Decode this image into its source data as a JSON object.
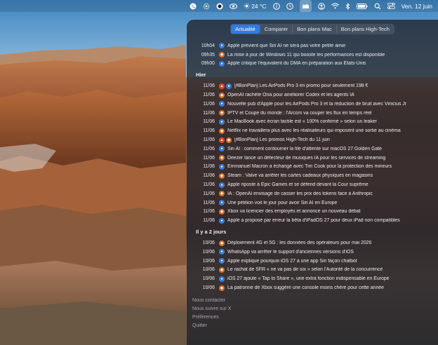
{
  "menubar": {
    "weather": "24 °C",
    "datetime": "Ven. 12 juin"
  },
  "tabs": [
    {
      "label": "Actualité",
      "active": true
    },
    {
      "label": "Comparer",
      "active": false
    },
    {
      "label": "Bon plans Mac",
      "active": false
    },
    {
      "label": "Bon plans High-Tech",
      "active": false
    }
  ],
  "sections": {
    "today": [
      {
        "time": "10h04",
        "icon": "blue",
        "title": "Apple prévient que Siri AI ne sera pas votre petite amie"
      },
      {
        "time": "09h35",
        "icon": "orange",
        "title": "La mise à jour de Windows 11 qui booste les performances est disponible"
      },
      {
        "time": "09h00",
        "icon": "blue",
        "title": "Apple critique l'équivalent du DMA en préparation aux États-Unis"
      }
    ],
    "yesterday_label": "Hier",
    "yesterday": [
      {
        "time": "11/06",
        "fire": true,
        "icon": "blue",
        "title": "[#BonPlan] Les AirPods Pro 3 en promo pour seulement 198 €"
      },
      {
        "time": "11/06",
        "icon": "orange",
        "title": "OpenAI rachète Ona pour améliorer Codex et les agents IA"
      },
      {
        "time": "11/06",
        "icon": "blue",
        "title": "Nouvelle pub d'Apple pour les AirPods Pro 3 et la réduction de bruit avec Vinicius Jr"
      },
      {
        "time": "11/06",
        "icon": "orange",
        "title": "IPTV et Coupe du monde : l'Arcom va couper les flux en temps réel"
      },
      {
        "time": "11/06",
        "icon": "blue",
        "title": "Le MacBook avec écran tactile est « 100% confirmé » selon un leaker"
      },
      {
        "time": "11/06",
        "icon": "orange",
        "title": "Netflix ne travaillera plus avec les réalisateurs qui imposent une sortie au cinéma"
      },
      {
        "time": "11/06",
        "fire": true,
        "icon": "orange",
        "title": "[#BonPlan] Les promos High-Tech du 11 juin"
      },
      {
        "time": "11/06",
        "icon": "blue",
        "title": "Siri AI : comment contourner la file d'attente sur macOS 27 Golden Gate"
      },
      {
        "time": "11/06",
        "icon": "orange",
        "title": "Deezer lance un détecteur de musiques IA pour les services de streaming"
      },
      {
        "time": "11/06",
        "icon": "blue",
        "title": "Emmanuel Macron a échangé avec Tim Cook pour la protection des mineurs"
      },
      {
        "time": "11/06",
        "icon": "orange",
        "title": "Steam : Valve va arrêter les cartes cadeaux physiques en magasins"
      },
      {
        "time": "11/06",
        "icon": "blue",
        "title": "Apple riposte à Epic Games et se défend devant la Cour suprême"
      },
      {
        "time": "11/06",
        "icon": "orange",
        "title": "IA : OpenAI envisage de casser les prix des tokens face à Anthropic"
      },
      {
        "time": "11/06",
        "icon": "blue",
        "title": "Une pétition voit le jour pour avoir Siri AI en Europe"
      },
      {
        "time": "11/06",
        "icon": "orange",
        "title": "Xbox va licencier des employés et annonce un nouveau débat"
      },
      {
        "time": "11/06",
        "icon": "blue",
        "title": "Apple a proposé par erreur la bêta d'iPadOS 27 pour deux iPad non compatibles"
      }
    ],
    "older_label": "Il y a 2 jours",
    "older": [
      {
        "time": "10/06",
        "icon": "orange",
        "title": "Déploiement 4G et 5G : les données des opérateurs pour mai 2026"
      },
      {
        "time": "10/06",
        "icon": "blue",
        "title": "WhatsApp va arrêter le support d'anciennes versions d'iOS"
      },
      {
        "time": "10/06",
        "icon": "blue",
        "title": "Apple explique pourquoi iOS 27 a une app Siri façon chatbot"
      },
      {
        "time": "10/06",
        "icon": "orange",
        "title": "Le rachat de SFR « ne va pas de soi » selon l'Autorité de la concurrence"
      },
      {
        "time": "10/06",
        "icon": "blue",
        "title": "iOS 27 ajoute « Tap to Share », une extra fonction indispensable en Europe"
      },
      {
        "time": "10/06",
        "icon": "orange",
        "title": "La patronne de Xbox suggère une console moins chère pour cette année"
      }
    ]
  },
  "footer": [
    {
      "label": "Nous contacter"
    },
    {
      "label": "Nous suivre sur X"
    },
    {
      "label": "Préférences"
    },
    {
      "label": "Quitter"
    }
  ],
  "colors": {
    "accent": "#2f7be8",
    "source_blue": "#3b7dd8",
    "source_orange": "#d9702a",
    "hot": "#e24a2a"
  }
}
